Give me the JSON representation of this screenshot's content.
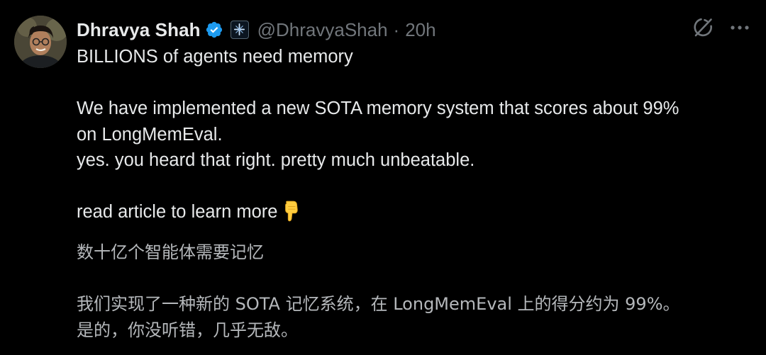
{
  "author": {
    "name": "Dhravya Shah",
    "handle": "@DhravyaShah",
    "separator": "·",
    "time": "20h",
    "verified_color": "#1d9bf0"
  },
  "icons": {
    "avatar": "profile-photo",
    "verified": "verified-badge-icon",
    "affiliate": "affiliate-badge-icon",
    "grok": "grok-icon",
    "more": "more-icon",
    "emoji": "backhand-index-pointing-down"
  },
  "tweet": {
    "line1": "BILLIONS of agents need memory",
    "line2": "We have implemented a new SOTA memory system that scores about 99%",
    "line3": "on LongMemEval.",
    "line4": "yes. you heard that right. pretty much unbeatable.",
    "line5": "read article to learn more"
  },
  "translation": {
    "line1": "数十亿个智能体需要记忆",
    "line2": "我们实现了一种新的 SOTA 记忆系统，在 LongMemEval 上的得分约为 99%。",
    "line3": "是的，你没听错，几乎无敌。"
  },
  "colors": {
    "background": "#000000",
    "text": "#e7e9ea",
    "muted": "#71767b",
    "translation": "#b5b8bb"
  }
}
